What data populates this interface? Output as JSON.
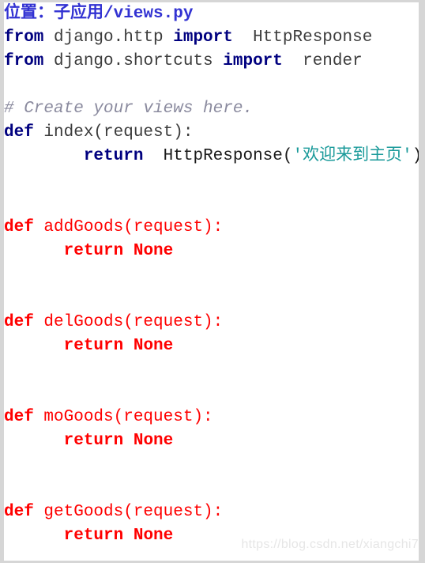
{
  "file": {
    "title_label": "位置：子应用/views.py"
  },
  "watermark": {
    "text": "https://blog.csdn.net/xiangchi7"
  },
  "colors": {
    "frame_border": "#d6d6d6",
    "background": "#ffffff",
    "title": "#3232d2",
    "keyword": "#00007f",
    "identifier": "#3c3c3c",
    "comment": "#8a8a9e",
    "string": "#1a9a9a",
    "highlight_red": "#ff0000",
    "watermark": "#e6e6e6"
  },
  "code": {
    "language": "python",
    "lines": [
      {
        "n": 1,
        "kind": "heading",
        "tokens": [
          {
            "text": "位置：子应用/views.py",
            "style": "title"
          }
        ]
      },
      {
        "n": 2,
        "kind": "import",
        "tokens": [
          {
            "text": "from",
            "style": "keyword"
          },
          {
            "text": " django.http ",
            "style": "identifier"
          },
          {
            "text": "import",
            "style": "keyword"
          },
          {
            "text": "  HttpResponse",
            "style": "identifier"
          }
        ]
      },
      {
        "n": 3,
        "kind": "import",
        "tokens": [
          {
            "text": "from",
            "style": "keyword"
          },
          {
            "text": " django.shortcuts ",
            "style": "identifier"
          },
          {
            "text": "import",
            "style": "keyword"
          },
          {
            "text": "  render",
            "style": "identifier"
          }
        ]
      },
      {
        "n": 4,
        "kind": "blank",
        "tokens": []
      },
      {
        "n": 5,
        "kind": "comment",
        "tokens": [
          {
            "text": "# Create your views here.",
            "style": "comment"
          }
        ]
      },
      {
        "n": 6,
        "kind": "def",
        "tokens": [
          {
            "text": "def",
            "style": "keyword"
          },
          {
            "text": " index(request):",
            "style": "identifier"
          }
        ]
      },
      {
        "n": 7,
        "kind": "body",
        "tokens": [
          {
            "text": "        ",
            "style": "plain"
          },
          {
            "text": "return",
            "style": "keyword"
          },
          {
            "text": "  HttpResponse(",
            "style": "black"
          },
          {
            "text": "'欢迎来到主页'",
            "style": "string"
          },
          {
            "text": ")",
            "style": "black"
          }
        ]
      },
      {
        "n": 8,
        "kind": "blank",
        "tokens": []
      },
      {
        "n": 9,
        "kind": "blank",
        "tokens": []
      },
      {
        "n": 10,
        "kind": "def",
        "tokens": [
          {
            "text": "def",
            "style": "red-bold"
          },
          {
            "text": " addGoods(request):",
            "style": "red"
          }
        ]
      },
      {
        "n": 11,
        "kind": "body",
        "tokens": [
          {
            "text": "      ",
            "style": "plain"
          },
          {
            "text": "return None",
            "style": "red-bold"
          }
        ]
      },
      {
        "n": 12,
        "kind": "blank",
        "tokens": []
      },
      {
        "n": 13,
        "kind": "blank",
        "tokens": []
      },
      {
        "n": 14,
        "kind": "def",
        "tokens": [
          {
            "text": "def",
            "style": "red-bold"
          },
          {
            "text": " delGoods(request):",
            "style": "red"
          }
        ]
      },
      {
        "n": 15,
        "kind": "body",
        "tokens": [
          {
            "text": "      ",
            "style": "plain"
          },
          {
            "text": "return None",
            "style": "red-bold"
          }
        ]
      },
      {
        "n": 16,
        "kind": "blank",
        "tokens": []
      },
      {
        "n": 17,
        "kind": "blank",
        "tokens": []
      },
      {
        "n": 18,
        "kind": "def",
        "tokens": [
          {
            "text": "def",
            "style": "red-bold"
          },
          {
            "text": " moGoods(request):",
            "style": "red"
          }
        ]
      },
      {
        "n": 19,
        "kind": "body",
        "tokens": [
          {
            "text": "      ",
            "style": "plain"
          },
          {
            "text": "return None",
            "style": "red-bold"
          }
        ]
      },
      {
        "n": 20,
        "kind": "blank",
        "tokens": []
      },
      {
        "n": 21,
        "kind": "blank",
        "tokens": []
      },
      {
        "n": 22,
        "kind": "def",
        "tokens": [
          {
            "text": "def",
            "style": "red-bold"
          },
          {
            "text": " getGoods(request):",
            "style": "red"
          }
        ]
      },
      {
        "n": 23,
        "kind": "body",
        "tokens": [
          {
            "text": "      ",
            "style": "plain"
          },
          {
            "text": "return None",
            "style": "red-bold"
          }
        ]
      }
    ]
  }
}
